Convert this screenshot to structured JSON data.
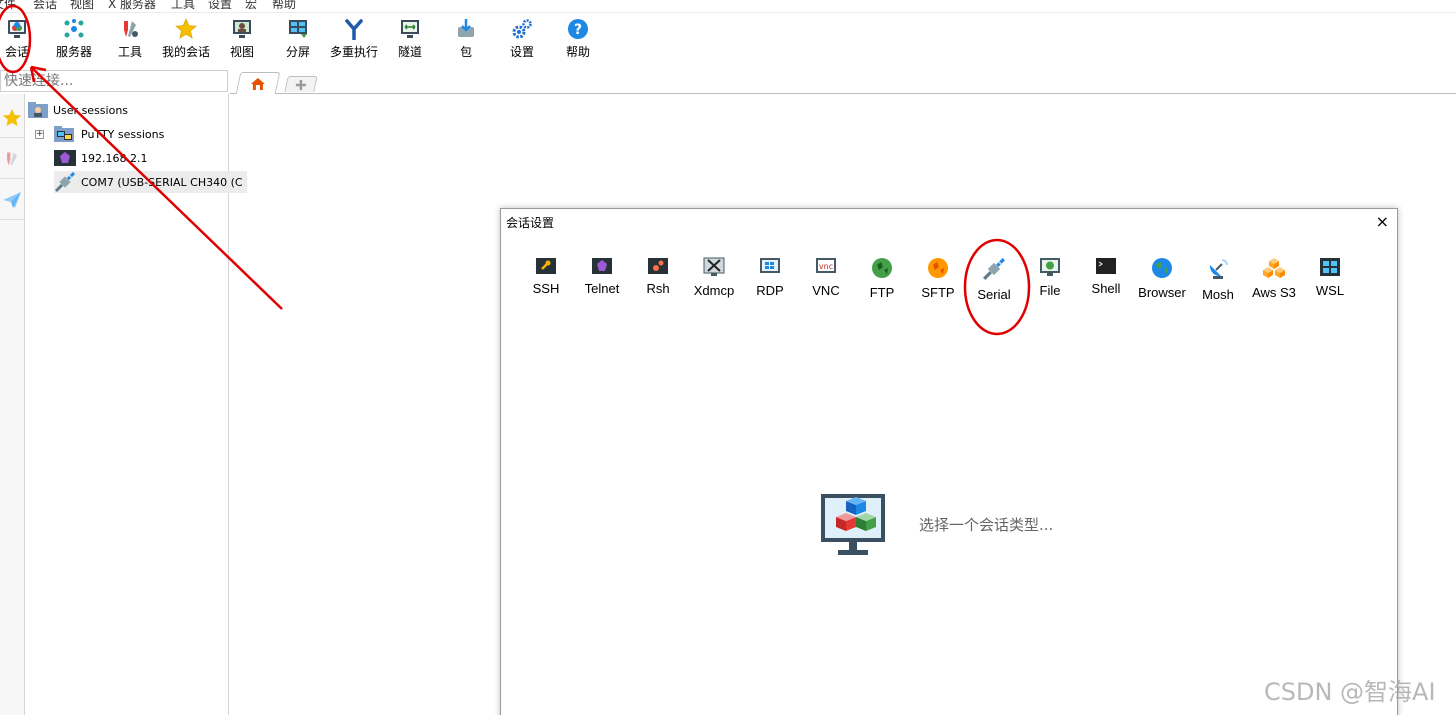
{
  "menu": [
    "文件",
    "会话",
    "视图",
    "X 服务器",
    "工具",
    "设置",
    "宏",
    "帮助"
  ],
  "toolbar": [
    {
      "label": "会话",
      "icon": "session-icon"
    },
    {
      "label": "服务器",
      "icon": "servers-icon"
    },
    {
      "label": "工具",
      "icon": "tools-icon"
    },
    {
      "label": "我的会话",
      "icon": "star-icon"
    },
    {
      "label": "视图",
      "icon": "view-icon"
    },
    {
      "label": "分屏",
      "icon": "split-icon"
    },
    {
      "label": "多重执行",
      "icon": "multiexec-icon"
    },
    {
      "label": "隧道",
      "icon": "tunnel-icon"
    },
    {
      "label": "包",
      "icon": "package-icon"
    },
    {
      "label": "设置",
      "icon": "settings-icon"
    },
    {
      "label": "帮助",
      "icon": "help-icon"
    }
  ],
  "quick_connect": {
    "placeholder": "快速连接..."
  },
  "tree": {
    "root": "User sessions",
    "children": [
      {
        "label": "PuTTY sessions",
        "icon": "putty-folder-icon",
        "expander": "+"
      },
      {
        "label": "192.168.2.1",
        "icon": "telnet-icon"
      },
      {
        "label": "COM7  (USB-SERIAL CH340 (C",
        "icon": "serial-plug-icon"
      }
    ]
  },
  "dialog": {
    "title": "会话设置",
    "close": "×",
    "types": [
      "SSH",
      "Telnet",
      "Rsh",
      "Xdmcp",
      "RDP",
      "VNC",
      "FTP",
      "SFTP",
      "Serial",
      "File",
      "Shell",
      "Browser",
      "Mosh",
      "Aws S3",
      "WSL"
    ],
    "placeholder": "选择一个会话类型..."
  },
  "watermark": "CSDN @智海AI",
  "colors": {
    "annotation_red": "#e00000",
    "accent_blue": "#1e88e5"
  }
}
